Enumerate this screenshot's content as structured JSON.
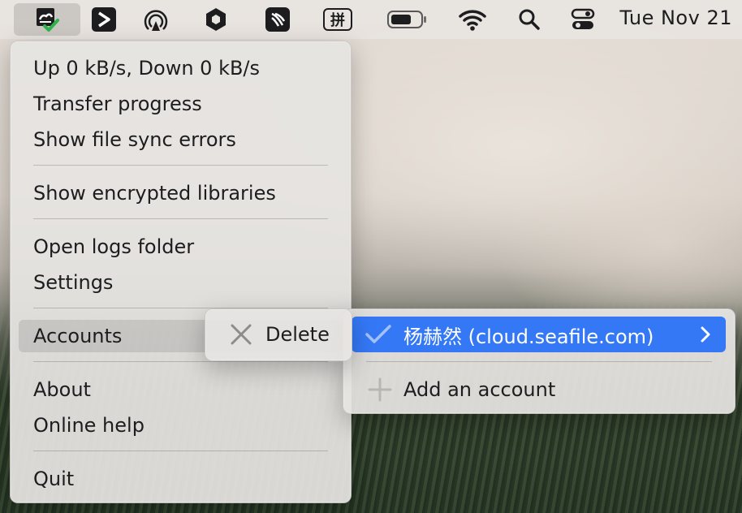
{
  "menubar": {
    "clock": "Tue Nov 21",
    "icons": [
      "seafile-icon",
      "bluetooth-play-icon",
      "airdrop-icon",
      "hexagon-app-icon",
      "feather-app-icon",
      "input-method-icon",
      "battery-icon",
      "wifi-icon",
      "spotlight-search-icon",
      "control-center-icon"
    ],
    "input_method_glyph": "拼"
  },
  "main_menu": {
    "items": [
      {
        "label": "Up 0 kB/s, Down 0 kB/s"
      },
      {
        "label": "Transfer progress"
      },
      {
        "label": "Show file sync errors"
      },
      {
        "label": "Show encrypted libraries"
      },
      {
        "label": "Open logs folder"
      },
      {
        "label": "Settings"
      },
      {
        "label": "Accounts"
      },
      {
        "label": "About"
      },
      {
        "label": "Online help"
      },
      {
        "label": "Quit"
      }
    ]
  },
  "delete_menu": {
    "label": "Delete",
    "icon": "close-icon"
  },
  "accounts_menu": {
    "selected_account": "杨赫然 (cloud.seafile.com)",
    "add_label": "Add an account"
  },
  "colors": {
    "highlight": "#3478f6",
    "menu_bg": "#e6e4e2",
    "text": "#1d1d1f"
  }
}
